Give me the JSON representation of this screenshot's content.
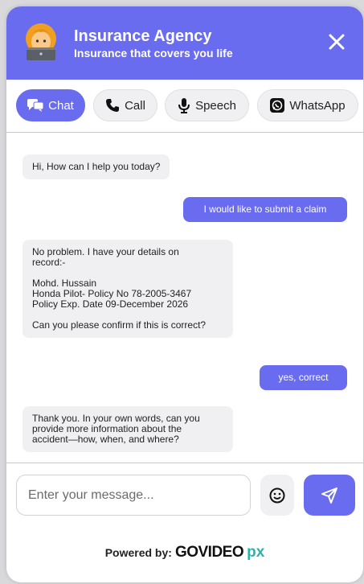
{
  "header": {
    "title": "Insurance Agency",
    "subtitle": "Insurance that covers you life",
    "avatar_icon": "woman-with-laptop-icon",
    "close_icon": "close-icon"
  },
  "tabs": [
    {
      "label": "Chat",
      "icon": "chat-bubbles-icon",
      "active": true
    },
    {
      "label": "Call",
      "icon": "phone-icon",
      "active": false
    },
    {
      "label": "Speech",
      "icon": "microphone-icon",
      "active": false
    },
    {
      "label": "WhatsApp",
      "icon": "whatsapp-icon",
      "active": false
    }
  ],
  "messages": [
    {
      "from": "bot",
      "lines": [
        "Hi, How can I help you today?"
      ]
    },
    {
      "from": "user",
      "lines": [
        "I would like to submit a claim"
      ]
    },
    {
      "from": "bot",
      "lines": [
        "No problem. I have your details on",
        "record:-",
        "",
        "Mohd. Hussain",
        "Honda Pilot- Policy No 78-2005-3467",
        "Policy Exp. Date 09-December 2026",
        "",
        "Can you please confirm if this is correct?"
      ]
    },
    {
      "from": "user",
      "lines": [
        "yes, correct"
      ]
    },
    {
      "from": "bot",
      "lines": [
        "Thank you. In your own words, can you",
        "provide more information about the",
        "accident—how, when, and where?"
      ]
    }
  ],
  "composer": {
    "placeholder": "Enter your message...",
    "emoji_icon": "smiley-icon",
    "send_icon": "send-icon"
  },
  "footer": {
    "powered_label": "Powered by:",
    "brand_text": "GOVIDEO",
    "brand_mark": "px"
  },
  "colors": {
    "accent": "#6a6cf0",
    "bubble_bot": "#f0f0f2",
    "brand_mark": "#2bb3a8"
  }
}
